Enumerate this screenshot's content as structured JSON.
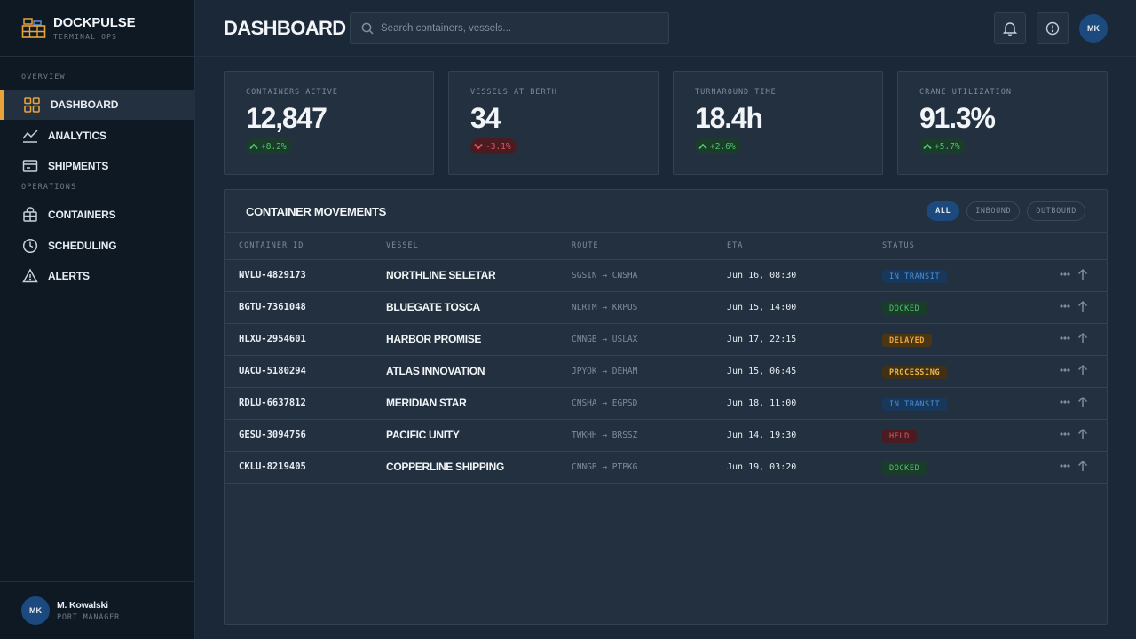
{
  "brand": {
    "title": "DOCKPULSE",
    "subtitle": "TERMINAL OPS"
  },
  "nav": {
    "section_overview": "OVERVIEW",
    "section_operations": "OPERATIONS",
    "items": [
      {
        "label": "DASHBOARD",
        "icon": "grid-icon",
        "active": true
      },
      {
        "label": "ANALYTICS",
        "icon": "chart-line-icon"
      },
      {
        "label": "SHIPMENTS",
        "icon": "box-icon"
      },
      {
        "label": "CONTAINERS",
        "icon": "container-icon"
      },
      {
        "label": "SCHEDULING",
        "icon": "clock-icon"
      },
      {
        "label": "ALERTS",
        "icon": "warning-icon"
      }
    ]
  },
  "user": {
    "initials": "MK",
    "name": "M. Kowalski",
    "role": "PORT MANAGER"
  },
  "header": {
    "title": "DASHBOARD",
    "search_placeholder": "Search containers, vessels...",
    "avatar_initials": "MK"
  },
  "kpis": [
    {
      "label": "CONTAINERS ACTIVE",
      "value": "12,847",
      "delta": "+8.2%",
      "trend": "up"
    },
    {
      "label": "VESSELS AT BERTH",
      "value": "34",
      "delta": "-3.1%",
      "trend": "down"
    },
    {
      "label": "TURNAROUND TIME",
      "value": "18.4h",
      "delta": "+2.6%",
      "trend": "up"
    },
    {
      "label": "CRANE UTILIZATION",
      "value": "91.3%",
      "delta": "+5.7%",
      "trend": "up"
    }
  ],
  "movements": {
    "title": "CONTAINER MOVEMENTS",
    "filters": [
      {
        "label": "ALL",
        "active": true
      },
      {
        "label": "INBOUND"
      },
      {
        "label": "OUTBOUND"
      }
    ],
    "columns": [
      "CONTAINER ID",
      "VESSEL",
      "ROUTE",
      "ETA",
      "STATUS"
    ],
    "rows": [
      {
        "id": "NVLU-4829173",
        "vessel": "NORTHLINE SELETAR",
        "route": "SGSIN → CNSHA",
        "eta": "Jun 16, 08:30",
        "status": "IN TRANSIT",
        "status_kind": "transit"
      },
      {
        "id": "BGTU-7361048",
        "vessel": "BLUEGATE TOSCA",
        "route": "NLRTM → KRPUS",
        "eta": "Jun 15, 14:00",
        "status": "DOCKED",
        "status_kind": "docked"
      },
      {
        "id": "HLXU-2954601",
        "vessel": "HARBOR PROMISE",
        "route": "CNNGB → USLAX",
        "eta": "Jun 17, 22:15",
        "status": "DELAYED",
        "status_kind": "delayed"
      },
      {
        "id": "UACU-5180294",
        "vessel": "ATLAS INNOVATION",
        "route": "JPYOK → DEHAM",
        "eta": "Jun 15, 06:45",
        "status": "PROCESSING",
        "status_kind": "processing"
      },
      {
        "id": "RDLU-6637812",
        "vessel": "MERIDIAN STAR",
        "route": "CNSHA → EGPSD",
        "eta": "Jun 18, 11:00",
        "status": "IN TRANSIT",
        "status_kind": "transit"
      },
      {
        "id": "GESU-3094756",
        "vessel": "PACIFIC UNITY",
        "route": "TWKHH → BRSSZ",
        "eta": "Jun 14, 19:30",
        "status": "HELD",
        "status_kind": "held"
      },
      {
        "id": "CKLU-8219405",
        "vessel": "COPPERLINE SHIPPING",
        "route": "CNNGB → PTPKG",
        "eta": "Jun 19, 03:20",
        "status": "DOCKED",
        "status_kind": "docked"
      }
    ]
  },
  "colors": {
    "accent": "#e8a33a",
    "primary": "#1c4a7e",
    "up": "#4fc46f",
    "down": "#e4545c"
  }
}
